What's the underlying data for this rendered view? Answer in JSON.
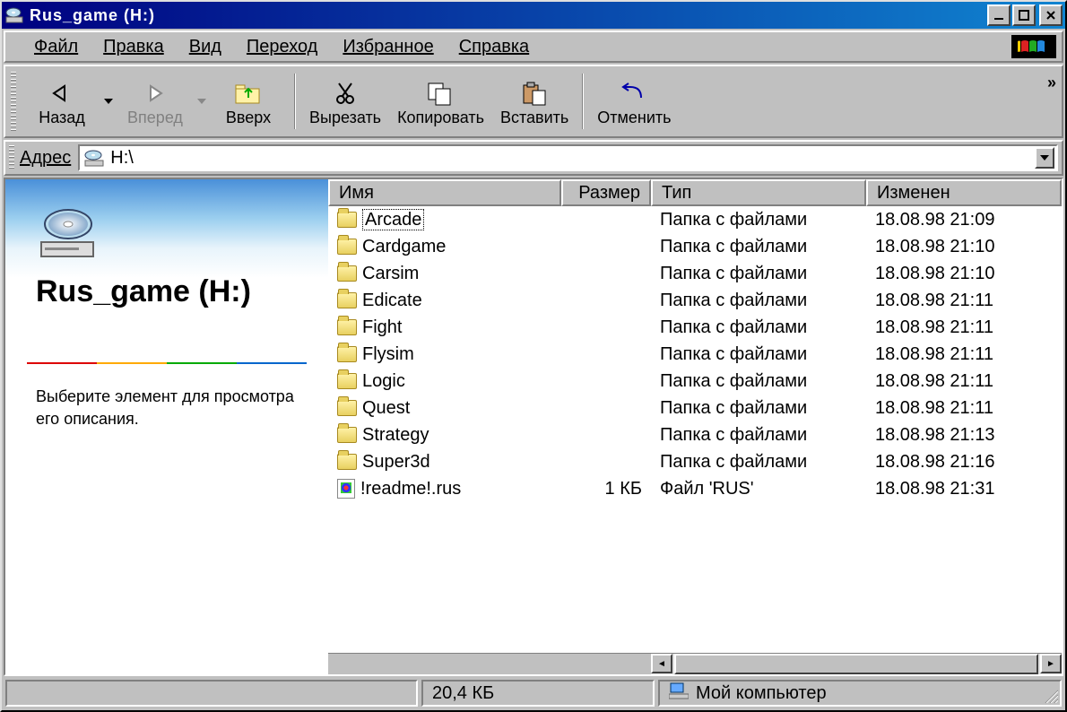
{
  "window": {
    "title": "Rus_game (H:)"
  },
  "menu": {
    "file": "Файл",
    "edit": "Правка",
    "view": "Вид",
    "go": "Переход",
    "favorites": "Избранное",
    "help": "Справка"
  },
  "toolbar": {
    "back": "Назад",
    "forward": "Вперед",
    "up": "Вверх",
    "cut": "Вырезать",
    "copy": "Копировать",
    "paste": "Вставить",
    "undo": "Отменить"
  },
  "address": {
    "label": "Адрес",
    "path": "H:\\"
  },
  "columns": {
    "name": "Имя",
    "size": "Размер",
    "type": "Тип",
    "modified": "Изменен"
  },
  "left": {
    "drive_name": "Rus_game (H:)",
    "hint": "Выберите элемент для просмотра его описания."
  },
  "items": [
    {
      "icon": "folder",
      "name": "Arcade",
      "size": "",
      "type": "Папка с файлами",
      "date": "18.08.98 21:09",
      "focused": true
    },
    {
      "icon": "folder",
      "name": "Cardgame",
      "size": "",
      "type": "Папка с файлами",
      "date": "18.08.98 21:10"
    },
    {
      "icon": "folder",
      "name": "Carsim",
      "size": "",
      "type": "Папка с файлами",
      "date": "18.08.98 21:10"
    },
    {
      "icon": "folder",
      "name": "Edicate",
      "size": "",
      "type": "Папка с файлами",
      "date": "18.08.98 21:11"
    },
    {
      "icon": "folder",
      "name": "Fight",
      "size": "",
      "type": "Папка с файлами",
      "date": "18.08.98 21:11"
    },
    {
      "icon": "folder",
      "name": "Flysim",
      "size": "",
      "type": "Папка с файлами",
      "date": "18.08.98 21:11"
    },
    {
      "icon": "folder",
      "name": "Logic",
      "size": "",
      "type": "Папка с файлами",
      "date": "18.08.98 21:11"
    },
    {
      "icon": "folder",
      "name": "Quest",
      "size": "",
      "type": "Папка с файлами",
      "date": "18.08.98 21:11"
    },
    {
      "icon": "folder",
      "name": "Strategy",
      "size": "",
      "type": "Папка с файлами",
      "date": "18.08.98 21:13"
    },
    {
      "icon": "folder",
      "name": "Super3d",
      "size": "",
      "type": "Папка с файлами",
      "date": "18.08.98 21:16"
    },
    {
      "icon": "file",
      "name": "!readme!.rus",
      "size": "1 КБ",
      "type": "Файл 'RUS'",
      "date": "18.08.98 21:31"
    }
  ],
  "status": {
    "size": "20,4 КБ",
    "location": "Мой компьютер"
  }
}
